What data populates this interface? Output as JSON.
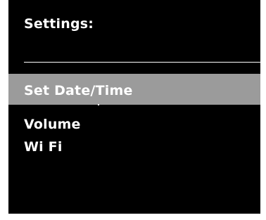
{
  "screen": {
    "title": "Settings:",
    "menu_items": [
      {
        "label": "Set Date/Time",
        "selected": true
      },
      {
        "label": "Volume",
        "selected": false
      },
      {
        "label": "Wi Fi",
        "selected": false
      }
    ]
  },
  "colors": {
    "background": "#000000",
    "text": "#ffffff",
    "highlight": "#9b9b9b",
    "outer": "#ffffff"
  }
}
